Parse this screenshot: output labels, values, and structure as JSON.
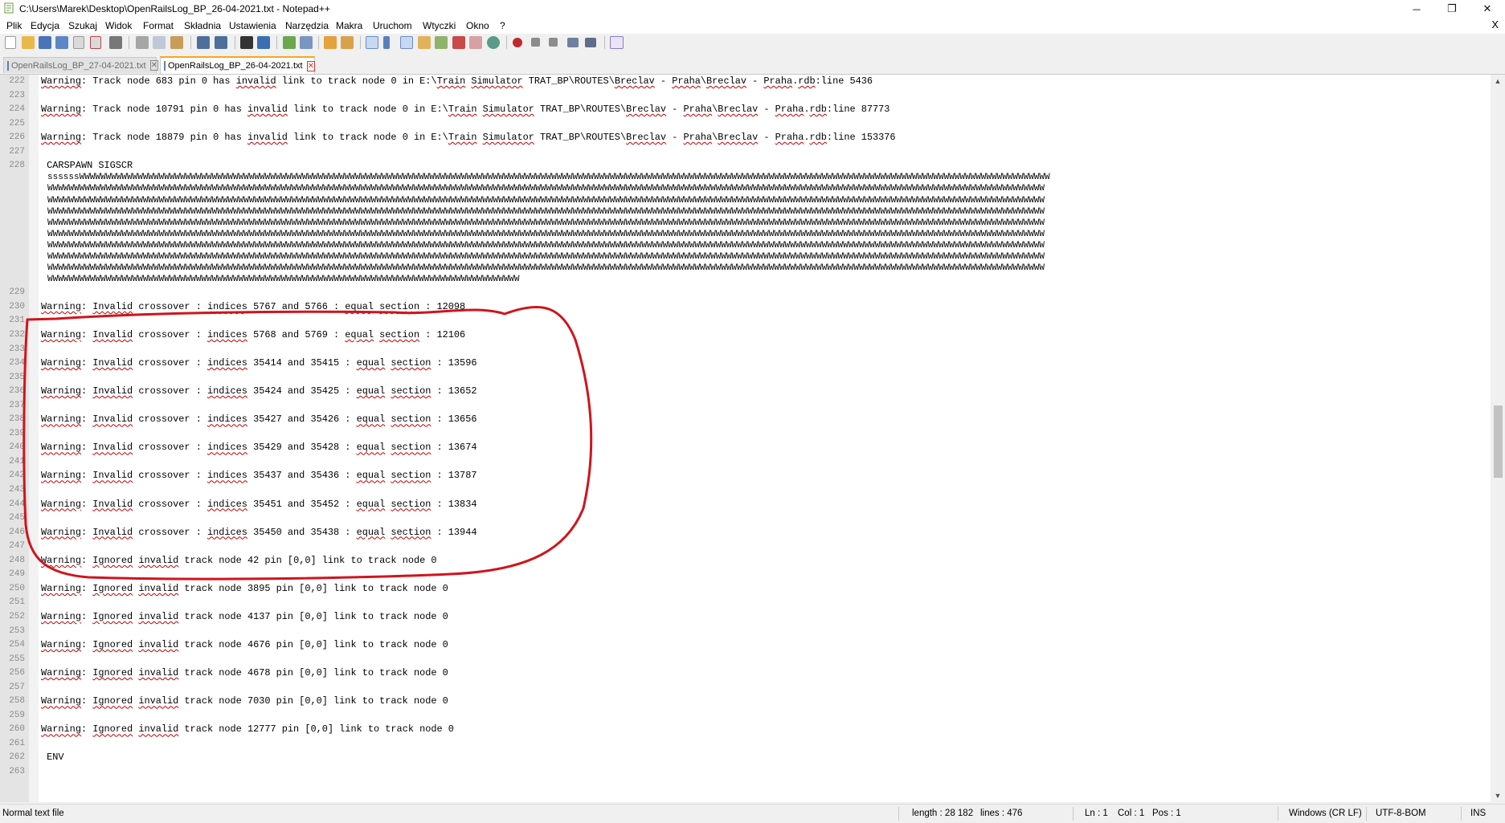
{
  "window": {
    "title": "C:\\Users\\Marek\\Desktop\\OpenRailsLog_BP_26-04-2021.txt - Notepad++",
    "min_glyph": "─",
    "restore_glyph": "❐",
    "close_glyph": "✕",
    "doc_close_glyph": "X"
  },
  "menu": [
    "Plik",
    "Edycja",
    "Szukaj",
    "Widok",
    "Format",
    "Składnia",
    "Ustawienia",
    "Narzędzia",
    "Makra",
    "Uruchom",
    "Wtyczki",
    "Okno",
    "?"
  ],
  "tabs": [
    {
      "label": "OpenRailsLog_BP_27-04-2021.txt",
      "active": false
    },
    {
      "label": "OpenRailsLog_BP_26-04-2021.txt",
      "active": true
    }
  ],
  "tab_close_glyph": "✕",
  "editor": {
    "line_numbers": [
      "222",
      "223",
      "224",
      "225",
      "226",
      "227",
      "228",
      "229",
      "230",
      "231",
      "232",
      "233",
      "234",
      "235",
      "236",
      "237",
      "238",
      "239",
      "240",
      "241",
      "242",
      "243",
      "244",
      "245",
      "246",
      "247",
      "248",
      "249",
      "250",
      "251",
      "252",
      "253",
      "254",
      "255",
      "256",
      "257",
      "258",
      "259",
      "260",
      "261",
      "262",
      "263"
    ],
    "lines": [
      [
        "",
        "Warning: Track node 683 pin 0 has invalid link to track node 0 in E:\\Train Simulator TRAT_BP\\ROUTES\\Breclav - Praha\\Breclav - Praha.rdb:line 5436"
      ],
      [
        "",
        ""
      ],
      [
        "",
        "Warning: Track node 10791 pin 0 has invalid link to track node 0 in E:\\Train Simulator TRAT_BP\\ROUTES\\Breclav - Praha\\Breclav - Praha.rdb:line 87773"
      ],
      [
        "",
        ""
      ],
      [
        "",
        "Warning: Track node 18879 pin 0 has invalid link to track node 0 in E:\\Train Simulator TRAT_BP\\ROUTES\\Breclav - Praha\\Breclav - Praha.rdb:line 153376"
      ],
      [
        "",
        ""
      ],
      [
        "",
        " CARSPAWN SIGSCR"
      ],
      [
        "",
        ""
      ],
      [
        "",
        "Warning: Invalid crossover : indices 5767 and 5766 : equal section : 12098"
      ],
      [
        "",
        ""
      ],
      [
        "",
        "Warning: Invalid crossover : indices 5768 and 5769 : equal section : 12106"
      ],
      [
        "",
        ""
      ],
      [
        "",
        "Warning: Invalid crossover : indices 35414 and 35415 : equal section : 13596"
      ],
      [
        "",
        ""
      ],
      [
        "",
        "Warning: Invalid crossover : indices 35424 and 35425 : equal section : 13652"
      ],
      [
        "",
        ""
      ],
      [
        "",
        "Warning: Invalid crossover : indices 35427 and 35426 : equal section : 13656"
      ],
      [
        "",
        ""
      ],
      [
        "",
        "Warning: Invalid crossover : indices 35429 and 35428 : equal section : 13674"
      ],
      [
        "",
        ""
      ],
      [
        "",
        "Warning: Invalid crossover : indices 35437 and 35436 : equal section : 13787"
      ],
      [
        "",
        ""
      ],
      [
        "",
        "Warning: Invalid crossover : indices 35451 and 35452 : equal section : 13834"
      ],
      [
        "",
        ""
      ],
      [
        "",
        "Warning: Invalid crossover : indices 35450 and 35438 : equal section : 13944"
      ],
      [
        "",
        ""
      ],
      [
        "",
        "Warning: Ignored invalid track node 42 pin [0,0] link to track node 0"
      ],
      [
        "",
        ""
      ],
      [
        "",
        "Warning: Ignored invalid track node 3895 pin [0,0] link to track node 0"
      ],
      [
        "",
        ""
      ],
      [
        "",
        "Warning: Ignored invalid track node 4137 pin [0,0] link to track node 0"
      ],
      [
        "",
        ""
      ],
      [
        "",
        "Warning: Ignored invalid track node 4676 pin [0,0] link to track node 0"
      ],
      [
        "",
        ""
      ],
      [
        "",
        "Warning: Ignored invalid track node 4678 pin [0,0] link to track node 0"
      ],
      [
        "",
        ""
      ],
      [
        "",
        "Warning: Ignored invalid track node 7030 pin [0,0] link to track node 0"
      ],
      [
        "",
        ""
      ],
      [
        "",
        "Warning: Ignored invalid track node 12777 pin [0,0] link to track node 0"
      ],
      [
        "",
        ""
      ],
      [
        "",
        " ENV"
      ],
      [
        "",
        ""
      ]
    ],
    "wrapped_lines": [
      "ssssssWWWWWWWWWWWWWWWWWWWWWWWWWWWWWWWWWWWWWWWWWWWWWWWWWWWWWWWWWWWWWWWWWWWWWWWWWWWWWWWWWWWWWWWWWWWWWWWWWWWWWWWWWWWWWWWWWWWWWWWWWWWWWWWWWWWWWWWWWWWWWWWWWWWWWWWWWWWWWWWWWWWWWWWWWWWWWWWWWWWWWWW",
      "WWWWWWWWWWWWWWWWWWWWWWWWWWWWWWWWWWWWWWWWWWWWWWWWWWWWWWWWWWWWWWWWWWWWWWWWWWWWWWWWWWWWWWWWWWWWWWWWWWWWWWWWWWWWWWWWWWWWWWWWWWWWWWWWWWWWWWWWWWWWWWWWWWWWWWWWWWWWWWWWWWWWWWWWWWWWWWWWWWWWWWWWWWWW",
      "WWWWWWWWWWWWWWWWWWWWWWWWWWWWWWWWWWWWWWWWWWWWWWWWWWWWWWWWWWWWWWWWWWWWWWWWWWWWWWWWWWWWWWWWWWWWWWWWWWWWWWWWWWWWWWWWWWWWWWWWWWWWWWWWWWWWWWWWWWWWWWWWWWWWWWWWWWWWWWWWWWWWWWWWWWWWWWWWWWWWWWWWWWWW",
      "WWWWWWWWWWWWWWWWWWWWWWWWWWWWWWWWWWWWWWWWWWWWWWWWWWWWWWWWWWWWWWWWWWWWWWWWWWWWWWWWWWWWWWWWWWWWWWWWWWWWWWWWWWWWWWWWWWWWWWWWWWWWWWWWWWWWWWWWWWWWWWWWWWWWWWWWWWWWWWWWWWWWWWWWWWWWWWWWWWWWWWWWWWWW",
      "WWWWWWWWWWWWWWWWWWWWWWWWWWWWWWWWWWWWWWWWWWWWWWWWWWWWWWWWWWWWWWWWWWWWWWWWWWWWWWWWWWWWWWWWWWWWWWWWWWWWWWWWWWWWWWWWWWWWWWWWWWWWWWWWWWWWWWWWWWWWWWWWWWWWWWWWWWWWWWWWWWWWWWWWWWWWWWWWWWWWWWWWWWWW",
      "WWWWWWWWWWWWWWWWWWWWWWWWWWWWWWWWWWWWWWWWWWWWWWWWWWWWWWWWWWWWWWWWWWWWWWWWWWWWWWWWWWWWWWWWWWWWWWWWWWWWWWWWWWWWWWWWWWWWWWWWWWWWWWWWWWWWWWWWWWWWWWWWWWWWWWWWWWWWWWWWWWWWWWWWWWWWWWWWWWWWWWWWWWWW",
      "WWWWWWWWWWWWWWWWWWWWWWWWWWWWWWWWWWWWWWWWWWWWWWWWWWWWWWWWWWWWWWWWWWWWWWWWWWWWWWWWWWWWWWWWWWWWWWWWWWWWWWWWWWWWWWWWWWWWWWWWWWWWWWWWWWWWWWWWWWWWWWWWWWWWWWWWWWWWWWWWWWWWWWWWWWWWWWWWWWWWWWWWWWWW",
      "WWWWWWWWWWWWWWWWWWWWWWWWWWWWWWWWWWWWWWWWWWWWWWWWWWWWWWWWWWWWWWWWWWWWWWWWWWWWWWWWWWWWWWWWWWWWWWWWWWWWWWWWWWWWWWWWWWWWWWWWWWWWWWWWWWWWWWWWWWWWWWWWWWWWWWWWWWWWWWWWWWWWWWWWWWWWWWWWWWWWWWWWWWWW",
      "WWWWWWWWWWWWWWWWWWWWWWWWWWWWWWWWWWWWWWWWWWWWWWWWWWWWWWWWWWWWWWWWWWWWWWWWWWWWWWWWWWWWWWWWWWWWWWWWWWWWWWWWWWWWWWWWWWWWWWWWWWWWWWWWWWWWWWWWWWWWWWWWWWWWWWWWWWWWWWWWWWWWWWWWWWWWWWWWWWWWWWWWWWWW",
      "WWWWWWWWWWWWWWWWWWWWWWWWWWWWWWWWWWWWWWWWWWWWWWWWWWWWWWWWWWWWWWWWWWWWWWWWWWWWWWWWWWWWWWWWW"
    ],
    "spell_words": [
      "Warning",
      "invalid",
      "Train",
      "Simulator",
      "Breclav",
      "Praha",
      "rdb",
      "Invalid",
      "indices",
      "equal",
      "section",
      "Ignored"
    ],
    "highlight_color": "#d0141c"
  },
  "status": {
    "file_type": "Normal text file",
    "length": "length : 28 182",
    "lines": "lines : 476",
    "ln": "Ln : 1",
    "col": "Col : 1",
    "pos": "Pos : 1",
    "eol": "Windows (CR LF)",
    "encoding": "UTF-8-BOM",
    "mode": "INS"
  }
}
